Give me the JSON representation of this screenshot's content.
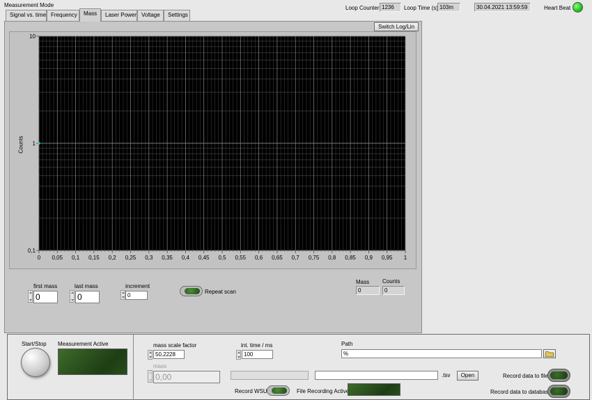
{
  "header": {
    "mode_label": "Measurement Mode",
    "loop_counter_label": "Loop Counter",
    "loop_counter_value": "1236",
    "loop_time_label": "Loop Time (s)",
    "loop_time_value": "103m",
    "datetime": "30.04.2021 13:59:59",
    "heartbeat_label": "Heart Beat",
    "heartbeat_color": "#22cc22"
  },
  "tabs": [
    {
      "label": "Signal vs. time"
    },
    {
      "label": "Frequency"
    },
    {
      "label": "Mass"
    },
    {
      "label": "Laser Power"
    },
    {
      "label": "Voltage"
    },
    {
      "label": "Settings"
    }
  ],
  "active_tab": "Mass",
  "graph": {
    "switch_button": "Switch Log/Lin",
    "ylabel": "Counts",
    "y_ticks": [
      "10",
      "1",
      "0,1"
    ],
    "x_ticks": [
      "0",
      "0,05",
      "0,1",
      "0,15",
      "0,2",
      "0,25",
      "0,3",
      "0,35",
      "0,4",
      "0,45",
      "0,5",
      "0,55",
      "0,6",
      "0,65",
      "0,7",
      "0,75",
      "0,8",
      "0,85",
      "0,9",
      "0,95",
      "1"
    ]
  },
  "chart_data": {
    "type": "line",
    "title": "",
    "xlabel": "",
    "ylabel": "Counts",
    "xlim": [
      0,
      1
    ],
    "ylim": [
      0.1,
      10
    ],
    "y_scale": "log",
    "x_tick_labels": [
      "0",
      "0,05",
      "0,1",
      "0,15",
      "0,2",
      "0,25",
      "0,3",
      "0,35",
      "0,4",
      "0,45",
      "0,5",
      "0,55",
      "0,6",
      "0,65",
      "0,7",
      "0,75",
      "0,8",
      "0,85",
      "0,9",
      "0,95",
      "1"
    ],
    "y_tick_labels": [
      "10",
      "1",
      "0,1"
    ],
    "grid": true,
    "background": "#000000",
    "series": [
      {
        "x": [
          0
        ],
        "y": [
          1
        ],
        "color": "#33c8c8"
      }
    ]
  },
  "scan": {
    "first_mass_label": "first mass",
    "first_mass_value": "0",
    "last_mass_label": "last mass",
    "last_mass_value": "0",
    "increment_label": "increment",
    "increment_value": "0",
    "repeat_scan_label": "Repeat scan",
    "mass_label": "Mass",
    "mass_value": "0",
    "counts_label": "Counts",
    "counts_value": "0"
  },
  "bottom": {
    "start_stop_label": "Start/Stop",
    "measurement_active_label": "Measurement Active",
    "mass_scale_label": "mass scale factor",
    "mass_scale_value": "50,2228",
    "mass_label": "mass",
    "mass_value": "0,00",
    "int_time_label": "int. time / ms",
    "int_time_value": "100",
    "path_label": "Path",
    "path_value": "%",
    "tsv_label": ".tsv",
    "open_button": "Open",
    "record_wsu_label": "Record WSU",
    "file_recording_label": "File Recording Active",
    "record_file_label": "Record data to file",
    "record_db_label": "Record data to database"
  }
}
